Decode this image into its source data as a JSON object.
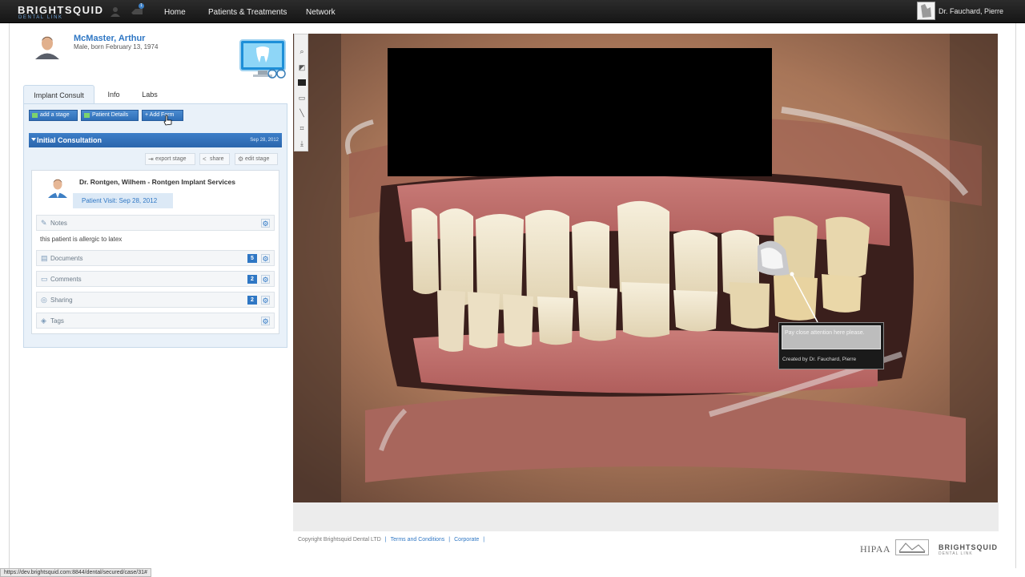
{
  "nav": {
    "brand": "BRIGHTSQUID",
    "brand_sub": "DENTAL LINK",
    "links": [
      "Home",
      "Patients & Treatments",
      "Network"
    ],
    "notification_count": "1",
    "user_name": "Dr. Fauchard, Pierre"
  },
  "patient": {
    "name": "McMaster, Arthur",
    "details": "Male, born February 13, 1974"
  },
  "tabs": [
    "Implant Consult",
    "Info",
    "Labs"
  ],
  "actions": {
    "add_stage": "add a stage",
    "patient_details": "Patient Details",
    "add_form": "+ Add Form"
  },
  "stage": {
    "title": "Initial Consultation",
    "date": "Sep 28, 2012",
    "export": "export stage",
    "share": "share",
    "edit": "edit stage"
  },
  "visit": {
    "provider": "Dr. Rontgen, Wilhem - Rontgen Implant Services",
    "visit_label": "Patient Visit: Sep 28, 2012"
  },
  "sections": {
    "notes": "Notes",
    "note_text": "this patient is allergic to latex",
    "documents": "Documents",
    "documents_count": "5",
    "comments": "Comments",
    "comments_count": "2",
    "sharing": "Sharing",
    "sharing_count": "2",
    "tags": "Tags"
  },
  "annotation": {
    "text": "Pay close attention here please.",
    "created_by": "Created by Dr. Fauchard, Pierre"
  },
  "footer": {
    "copyright": "Copyright Brightsquid Dental LTD",
    "terms": "Terms and Conditions",
    "corporate": "Corporate",
    "logo_hipaa": "HIPAA",
    "logo_brand": "BRIGHTSQUID",
    "logo_brand_sub": "DENTAL LINK"
  },
  "status_url": "https://dev.brightsquid.com:8844/dental/secured/case/31#"
}
